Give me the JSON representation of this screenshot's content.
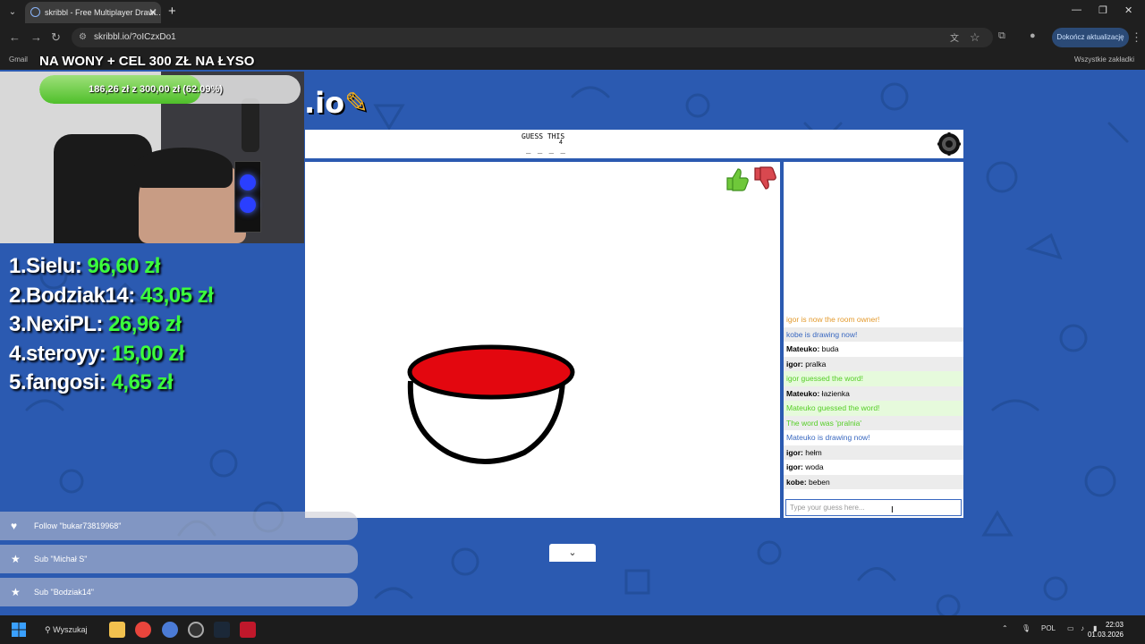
{
  "browser": {
    "tab_title": "skribbl - Free Multiplayer Drawi…",
    "tab_close": "✕",
    "new_tab": "+",
    "url": "skribbl.io/?oICzxDo1",
    "update_button": "Dokończ aktualizację",
    "bookmark_gmail": "Gmail",
    "bookmark_all": "Wszystkie zakładki",
    "window_minimize": "—",
    "window_restore": "❐",
    "window_close": "✕"
  },
  "overlay": {
    "goal_title": "NA WONY + CEL 300 ZŁ NA ŁYSO",
    "progress_text": "186,26 zł  z  300,00 zł  (62.09%)",
    "progress_fraction": 0.6209,
    "leaderboard": [
      {
        "name": "1.Sielu: ",
        "amount": "96,60 zł"
      },
      {
        "name": "2.Bodziak14: ",
        "amount": "43,05 zł"
      },
      {
        "name": "3.NexiPL: ",
        "amount": "26,96 zł"
      },
      {
        "name": "4.steroyy: ",
        "amount": "15,00 zł"
      },
      {
        "name": "5.fangosi: ",
        "amount": "4,65 zł"
      }
    ],
    "alerts": [
      {
        "icon": "heart",
        "glyph": "♥",
        "text": "Follow \"bukar73819968\""
      },
      {
        "icon": "star",
        "glyph": "★",
        "text": "Sub \"Michał S\""
      },
      {
        "icon": "star",
        "glyph": "★",
        "text": "Sub \"Bodziak14\""
      }
    ]
  },
  "game": {
    "logo": ".io",
    "guess_label": "GUESS THIS",
    "letter_count": "4",
    "blanks": "_ _ _ _",
    "chat_placeholder": "Type your guess here...",
    "collapse_glyph": "⌄",
    "chat": [
      {
        "type": "owner",
        "text": "igor is now the room owner!"
      },
      {
        "type": "draw",
        "text": "kobe is drawing now!"
      },
      {
        "type": "msg",
        "user": "Mateuko:",
        "text": " buda"
      },
      {
        "type": "msg",
        "user": "igor:",
        "text": " pralka"
      },
      {
        "type": "guessed",
        "text": "igor guessed the word!"
      },
      {
        "type": "msg",
        "user": "Mateuko:",
        "text": " łazienka"
      },
      {
        "type": "guessed",
        "text": "Mateuko guessed the word!"
      },
      {
        "type": "word",
        "text": "The word was 'pralnia'"
      },
      {
        "type": "draw",
        "text": "Mateuko is drawing now!"
      },
      {
        "type": "msg",
        "user": "igor:",
        "text": " hełm"
      },
      {
        "type": "msg",
        "user": "igor:",
        "text": " woda"
      },
      {
        "type": "msg",
        "user": "kobe:",
        "text": " beben"
      }
    ],
    "colors": {
      "accent": "#3968c0",
      "guessed": "#56ce27",
      "owner": "#e39a2d",
      "bowl_fill": "#e3070f"
    }
  },
  "taskbar": {
    "search": "Wyszukaj",
    "language": "POL",
    "time": "22:03",
    "date": "01.03.2026"
  }
}
